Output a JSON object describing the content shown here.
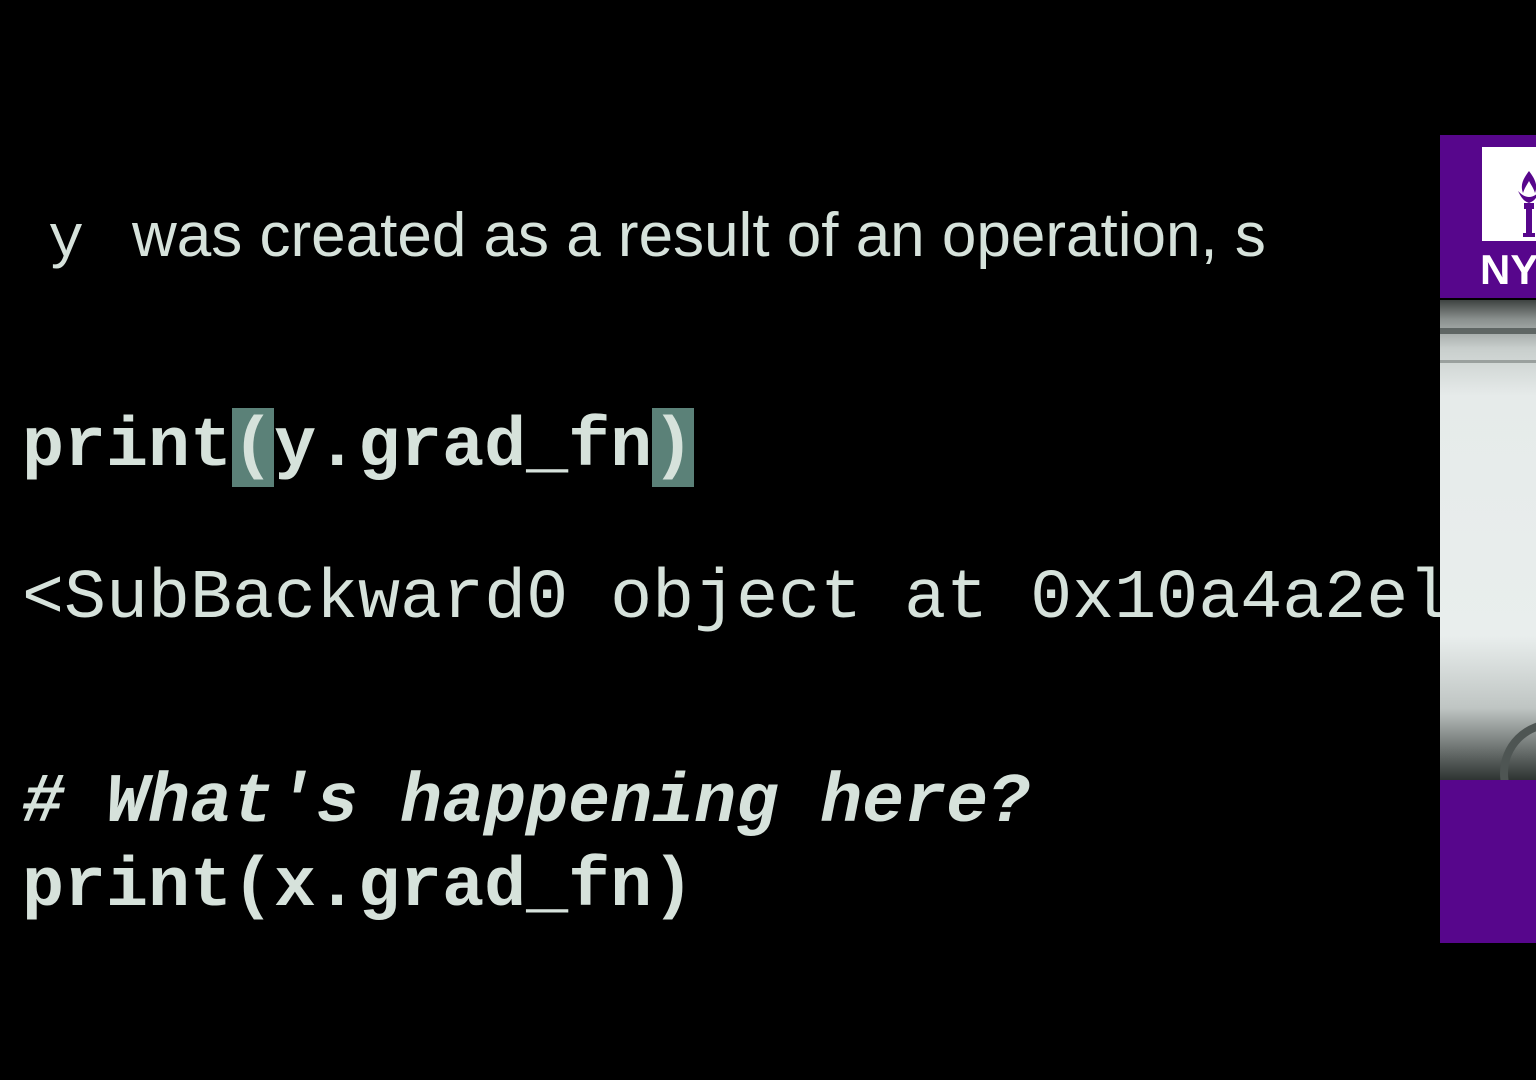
{
  "slide": {
    "prose": {
      "var_name": "y",
      "text": "was created as a result of an operation, s"
    },
    "code": {
      "print_y": {
        "prefix": "print",
        "open_paren": "(",
        "body": "y.grad_fn",
        "close_paren": ")"
      },
      "output": "<SubBackward0 object at 0x10a4a2el",
      "comment": "# What's happening here?",
      "print_x": "print(x.grad_fn)"
    }
  },
  "overlay": {
    "logo_text": "NY",
    "logo_icon": "torch-icon",
    "brand_color": "#57068c"
  },
  "colors": {
    "background": "#000000",
    "text": "#d6e2db",
    "bracket_highlight": "#5b8178"
  }
}
